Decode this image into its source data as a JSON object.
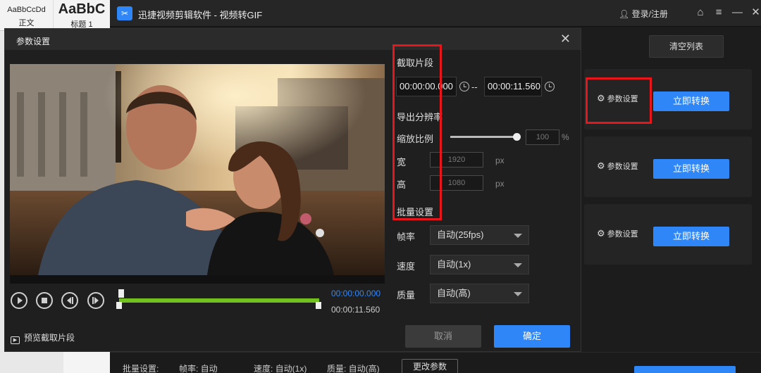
{
  "word": {
    "style1_sample": "AaBbCcDd",
    "style1_name": "正文",
    "style2_sample": "AaBbC",
    "style2_name": "标题 1"
  },
  "app": {
    "name": "迅捷视频剪辑软件 - 视频转GIF",
    "login": "登录/注册",
    "clear_list": "清空列表",
    "params_link": "参数设置",
    "convert": "立即转换"
  },
  "dialog": {
    "title": "参数设置",
    "close": "✕",
    "clip_section": "截取片段",
    "clip_start": "00:00:00.000",
    "clip_sep": "--",
    "clip_end": "00:00:11.560",
    "res_section": "导出分辨率",
    "scale_label": "缩放比例",
    "scale_value": "100",
    "scale_percent": 100,
    "scale_unit": "%",
    "width_label": "宽",
    "width_value": "1920",
    "height_label": "高",
    "height_value": "1080",
    "unit_px": "px",
    "batch_section": "批量设置",
    "framerate_label": "帧率",
    "framerate_value": "自动(25fps)",
    "speed_label": "速度",
    "speed_value": "自动(1x)",
    "quality_label": "质量",
    "quality_value": "自动(高)",
    "time_current": "00:00:00.000",
    "time_end": "00:00:11.560",
    "preview_clip": "预览截取片段",
    "cancel": "取消",
    "ok": "确定"
  },
  "batch_bar": {
    "label": "批量设置:",
    "framerate": "帧率: 自动",
    "speed": "速度: 自动(1x)",
    "quality": "质量: 自动(高)",
    "change": "更改参数"
  },
  "colors": {
    "accent": "#2f86f6",
    "timeline": "#72c21f",
    "annotation": "#e8151b"
  }
}
